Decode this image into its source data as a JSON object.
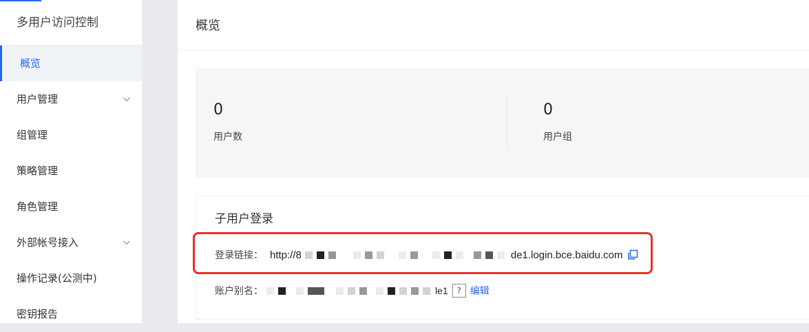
{
  "sidebar": {
    "title": "多用户访问控制",
    "items": [
      {
        "label": "概览",
        "active": true,
        "expandable": false
      },
      {
        "label": "用户管理",
        "active": false,
        "expandable": true
      },
      {
        "label": "组管理",
        "active": false,
        "expandable": false
      },
      {
        "label": "策略管理",
        "active": false,
        "expandable": false
      },
      {
        "label": "角色管理",
        "active": false,
        "expandable": false
      },
      {
        "label": "外部帐号接入",
        "active": false,
        "expandable": true
      },
      {
        "label": "操作记录(公测中)",
        "active": false,
        "expandable": false
      },
      {
        "label": "密钥报告",
        "active": false,
        "expandable": false
      }
    ]
  },
  "main": {
    "title": "概览",
    "stats": [
      {
        "value": "0",
        "label": "用户数"
      },
      {
        "value": "0",
        "label": "用户组"
      }
    ],
    "login": {
      "title": "子用户登录",
      "link_label": "登录链接：",
      "link_prefix": "http://8",
      "link_suffix": "de1.login.bce.baidu.com",
      "alias_label": "账户别名：",
      "alias_suffix": "le1",
      "help_glyph": "?",
      "edit_label": "编辑"
    }
  },
  "icons": {
    "copy": "copy-icon",
    "chevron": "chevron-down-icon",
    "help": "help-icon"
  },
  "colors": {
    "accent": "#2468f2",
    "highlight": "#e8302c"
  }
}
